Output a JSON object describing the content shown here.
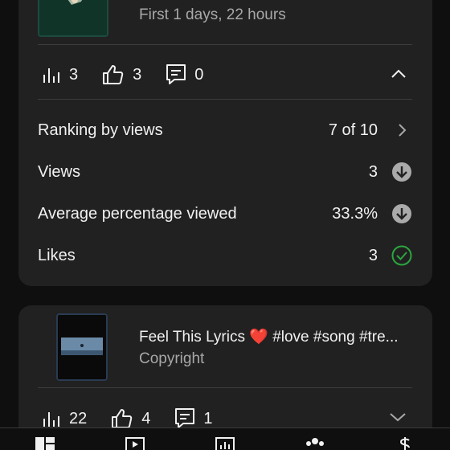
{
  "video1": {
    "subtitle": "First 1 days, 22 hours",
    "stats": {
      "views": "3",
      "likes": "3",
      "comments": "0"
    },
    "metrics": [
      {
        "label": "Ranking by views",
        "value": "7 of 10",
        "indicator": "chevron-right"
      },
      {
        "label": "Views",
        "value": "3",
        "indicator": "arrow-down-circle"
      },
      {
        "label": "Average percentage viewed",
        "value": "33.3%",
        "indicator": "arrow-down-circle"
      },
      {
        "label": "Likes",
        "value": "3",
        "indicator": "check-circle"
      }
    ]
  },
  "video2": {
    "title": "Feel This Lyrics ❤️ #love #song #tre...",
    "subtitle": "Copyright",
    "stats": {
      "views": "22",
      "likes": "4",
      "comments": "1"
    }
  },
  "colors": {
    "background": "#0f0f0f",
    "card": "#212121",
    "accent_green": "#2ba640",
    "muted": "#a8a8a8"
  },
  "bottom_nav": [
    "dashboard-icon",
    "content-icon",
    "analytics-icon",
    "community-icon",
    "earn-icon"
  ]
}
